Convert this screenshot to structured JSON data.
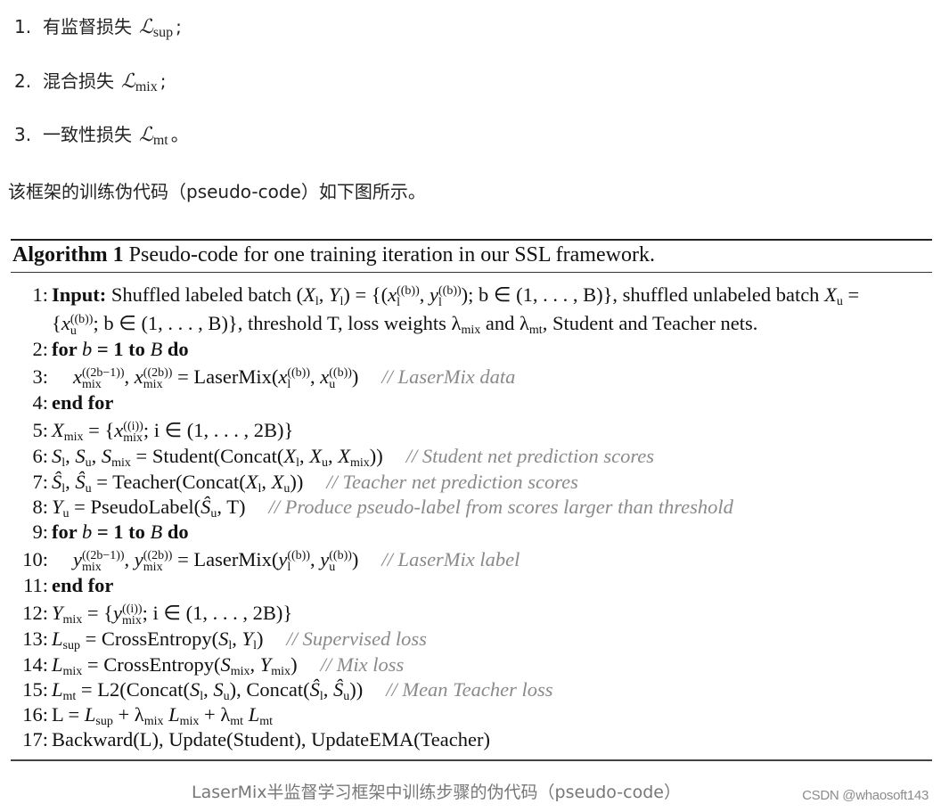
{
  "loss_list": [
    {
      "num": "1.",
      "text": "有监督损失",
      "symbol": "ℒ",
      "sub": "sup",
      "punct": ";"
    },
    {
      "num": "2.",
      "text": "混合损失",
      "symbol": "ℒ",
      "sub": "mix",
      "punct": ";"
    },
    {
      "num": "3.",
      "text": "一致性损失",
      "symbol": "ℒ",
      "sub": "mt",
      "punct": "。"
    }
  ],
  "intro_text": "该框架的训练伪代码（pseudo-code）如下图所示。",
  "algorithm": {
    "title_bold": "Algorithm 1",
    "title_rest": "Pseudo-code for one training iteration in our SSL framework.",
    "lines": [
      {
        "n": "1:",
        "kw": "Input:",
        "code": "Shuffled labeled batch (X_l, Y_l) = {(x_l^(b), y_l^(b)); b ∈ (1, . . . , B)}, shuffled unlabeled batch X_u =",
        "comment": ""
      },
      {
        "n": "",
        "kw": "",
        "code": "{x_u^(b); b ∈ (1, . . . , B)}, threshold T, loss weights λ_mix and λ_mt, Student and Teacher nets.",
        "comment": ""
      },
      {
        "n": "2:",
        "kw": "for b = 1 to B do",
        "code": "",
        "comment": ""
      },
      {
        "n": "3:",
        "kw": "",
        "code": "x_mix^(2b−1), x_mix^(2b) = LaserMix(x_l^(b), x_u^(b))",
        "comment": "// LaserMix data"
      },
      {
        "n": "4:",
        "kw": "end for",
        "code": "",
        "comment": ""
      },
      {
        "n": "5:",
        "kw": "",
        "code": "X_mix = {x_mix^(i); i ∈ (1, . . . , 2B)}",
        "comment": ""
      },
      {
        "n": "6:",
        "kw": "",
        "code": "S_l, S_u, S_mix = Student(Concat(X_l, X_u, X_mix))",
        "comment": "// Student net prediction scores"
      },
      {
        "n": "7:",
        "kw": "",
        "code": "Ŝ_l, Ŝ_u = Teacher(Concat(X_l, X_u))",
        "comment": "// Teacher net prediction scores"
      },
      {
        "n": "8:",
        "kw": "",
        "code": "Y_u = PseudoLabel(Ŝ_u, T)",
        "comment": "// Produce pseudo-label from scores larger than threshold"
      },
      {
        "n": "9:",
        "kw": "for b = 1 to B do",
        "code": "",
        "comment": ""
      },
      {
        "n": "10:",
        "kw": "",
        "code": "y_mix^(2b−1), y_mix^(2b) = LaserMix(y_l^(b), y_u^(b))",
        "comment": "// LaserMix label"
      },
      {
        "n": "11:",
        "kw": "end for",
        "code": "",
        "comment": ""
      },
      {
        "n": "12:",
        "kw": "",
        "code": "Y_mix = {y_mix^(i); i ∈ (1, . . . , 2B)}",
        "comment": ""
      },
      {
        "n": "13:",
        "kw": "",
        "code": "L_sup = CrossEntropy(S_l, Y_l)",
        "comment": "// Supervised loss"
      },
      {
        "n": "14:",
        "kw": "",
        "code": "L_mix = CrossEntropy(S_mix, Y_mix)",
        "comment": "// Mix loss"
      },
      {
        "n": "15:",
        "kw": "",
        "code": "L_mt = L2(Concat(S_l, S_u), Concat(Ŝ_l, Ŝ_u))",
        "comment": "// Mean Teacher loss"
      },
      {
        "n": "16:",
        "kw": "",
        "code": "L = L_sup + λ_mix L_mix + λ_mt L_mt",
        "comment": ""
      },
      {
        "n": "17:",
        "kw": "",
        "code": "Backward(L), Update(Student), UpdateEMA(Teacher)",
        "comment": ""
      }
    ]
  },
  "caption": "LaserMix半监督学习框架中训练步骤的伪代码（pseudo-code）",
  "watermark": "CSDN @whaosoft143",
  "colors": {
    "comment": "#8a8a8a",
    "caption": "#777777"
  }
}
